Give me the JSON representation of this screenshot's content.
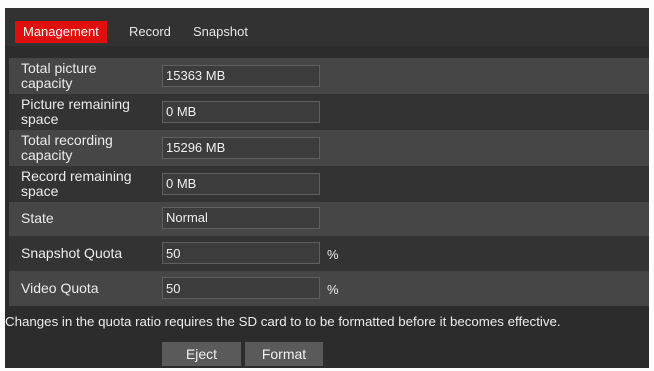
{
  "tabs": [
    {
      "label": "Management"
    },
    {
      "label": "Record"
    },
    {
      "label": "Snapshot"
    }
  ],
  "rows": [
    {
      "label": "Total picture capacity",
      "value": "15363 MB"
    },
    {
      "label": "Picture remaining space",
      "value": "0 MB"
    },
    {
      "label": "Total recording capacity",
      "value": "15296 MB"
    },
    {
      "label": "Record remaining space",
      "value": "0 MB"
    },
    {
      "label": "State",
      "value": "Normal"
    },
    {
      "label": "Snapshot Quota",
      "value": "50",
      "unit": "%"
    },
    {
      "label": "Video Quota",
      "value": "50",
      "unit": "%"
    }
  ],
  "note": "Changes in the quota ratio requires the SD card to to be formatted before it becomes effective.",
  "buttons": {
    "eject": "Eject",
    "format": "Format"
  },
  "colors": {
    "active_tab": "#e10e0e",
    "panel_bg": "#2c2c2c",
    "row_alt": "#464646"
  }
}
